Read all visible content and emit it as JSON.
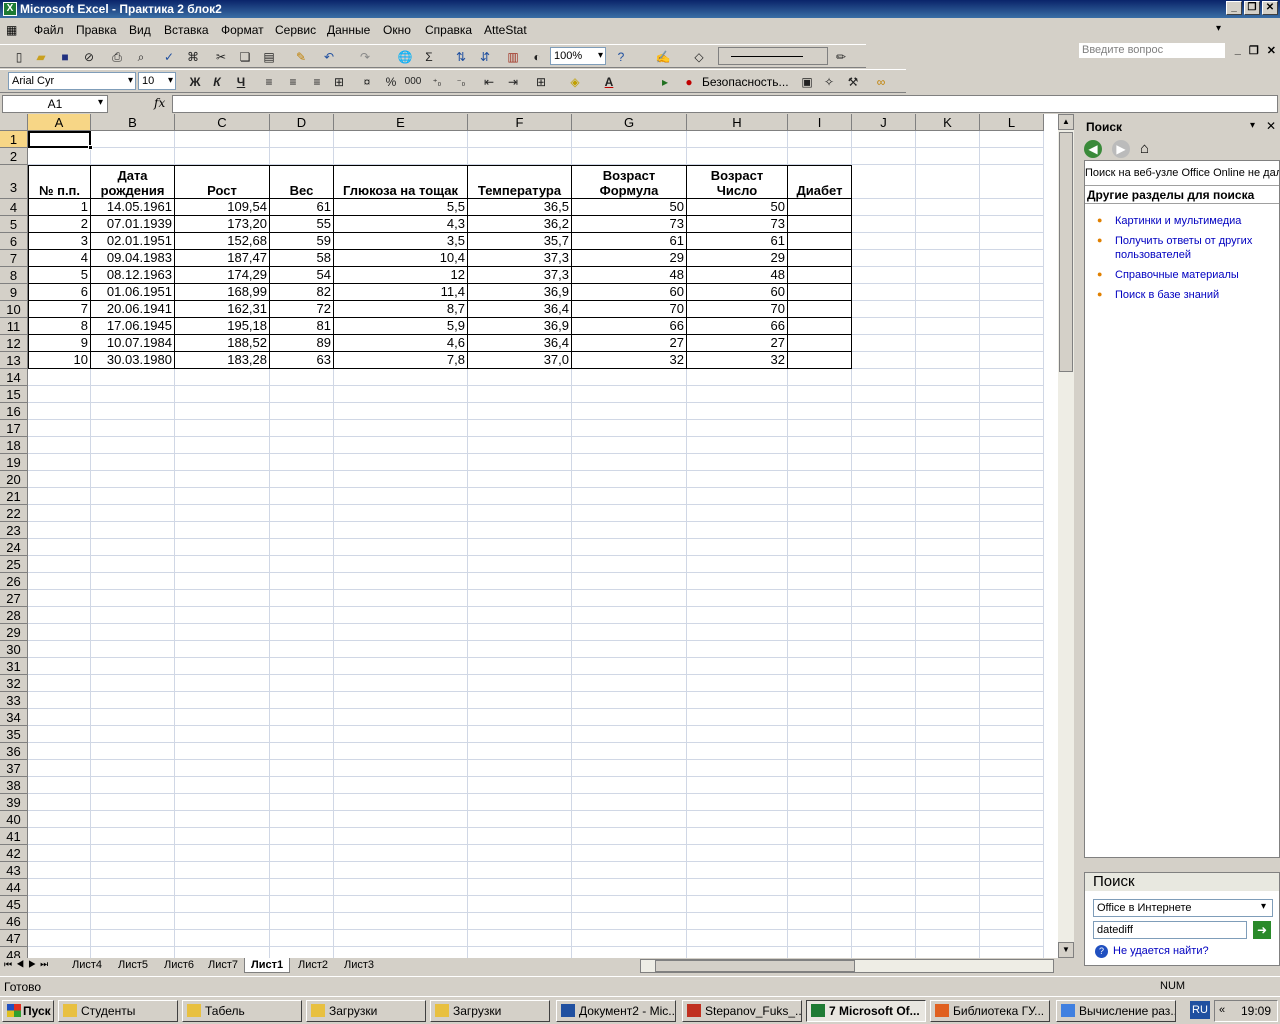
{
  "window": {
    "title": "Microsoft Excel - Практика 2 блок2"
  },
  "menu": [
    "Файл",
    "Правка",
    "Вид",
    "Вставка",
    "Формат",
    "Сервис",
    "Данные",
    "Окно",
    "Справка",
    "AtteStat"
  ],
  "ask_placeholder": "Введите вопрос",
  "toolbar1": {
    "zoom": "100%"
  },
  "toolbar2": {
    "font": "Arial Cyr",
    "size": "10",
    "bold": "Ж",
    "italic": "К",
    "underline": "Ч",
    "percent": "%",
    "thousands": "000",
    "security": "Безопасность..."
  },
  "formula": {
    "namebox": "A1",
    "fx": "fx",
    "value": ""
  },
  "columns": [
    "A",
    "B",
    "C",
    "D",
    "E",
    "F",
    "G",
    "H",
    "I",
    "J",
    "K",
    "L"
  ],
  "headers": {
    "A": "№ п.п.",
    "B": "Дата рождения",
    "C": "Рост",
    "D": "Вес",
    "E": "Глюкоза на тощак",
    "F": "Температура",
    "G": "Возраст Формула",
    "H": "Возраст Число",
    "I": "Диабет"
  },
  "rows": [
    [
      "1",
      "14.05.1961",
      "109,54",
      "61",
      "5,5",
      "36,5",
      "50",
      "50"
    ],
    [
      "2",
      "07.01.1939",
      "173,20",
      "55",
      "4,3",
      "36,2",
      "73",
      "73"
    ],
    [
      "3",
      "02.01.1951",
      "152,68",
      "59",
      "3,5",
      "35,7",
      "61",
      "61"
    ],
    [
      "4",
      "09.04.1983",
      "187,47",
      "58",
      "10,4",
      "37,3",
      "29",
      "29"
    ],
    [
      "5",
      "08.12.1963",
      "174,29",
      "54",
      "12",
      "37,3",
      "48",
      "48"
    ],
    [
      "6",
      "01.06.1951",
      "168,99",
      "82",
      "11,4",
      "36,9",
      "60",
      "60"
    ],
    [
      "7",
      "20.06.1941",
      "162,31",
      "72",
      "8,7",
      "36,4",
      "70",
      "70"
    ],
    [
      "8",
      "17.06.1945",
      "195,18",
      "81",
      "5,9",
      "36,9",
      "66",
      "66"
    ],
    [
      "9",
      "10.07.1984",
      "188,52",
      "89",
      "4,6",
      "36,4",
      "27",
      "27"
    ],
    [
      "10",
      "30.03.1980",
      "183,28",
      "63",
      "7,8",
      "37,0",
      "32",
      "32"
    ]
  ],
  "sheet_tabs": [
    "Лист4",
    "Лист5",
    "Лист6",
    "Лист7",
    "Лист1",
    "Лист2",
    "Лист3"
  ],
  "active_tab": "Лист1",
  "taskpane": {
    "title": "Поиск",
    "online_note": "Поиск на веб-узле Office Online не дал",
    "other_sections": "Другие разделы для поиска",
    "links": [
      "Картинки и мультимедиа",
      "Получить ответы от других пользователей",
      "Справочные материалы",
      "Поиск в базе знаний"
    ],
    "search_title": "Поиск",
    "scope": "Office в Интернете",
    "query": "datediff",
    "cant_find": "Не удается найти?"
  },
  "status": {
    "ready": "Готово",
    "num": "NUM"
  },
  "taskbar": {
    "start": "Пуск",
    "items": [
      "Студенты",
      "Табель",
      "Загрузки",
      "Загрузки",
      "Документ2 - Mic...",
      "Stepanov_Fuks_...",
      "7 Microsoft Of...",
      "Библиотека ГУ...",
      "Вычисление раз..."
    ],
    "lang": "RU",
    "time": "19:09"
  }
}
